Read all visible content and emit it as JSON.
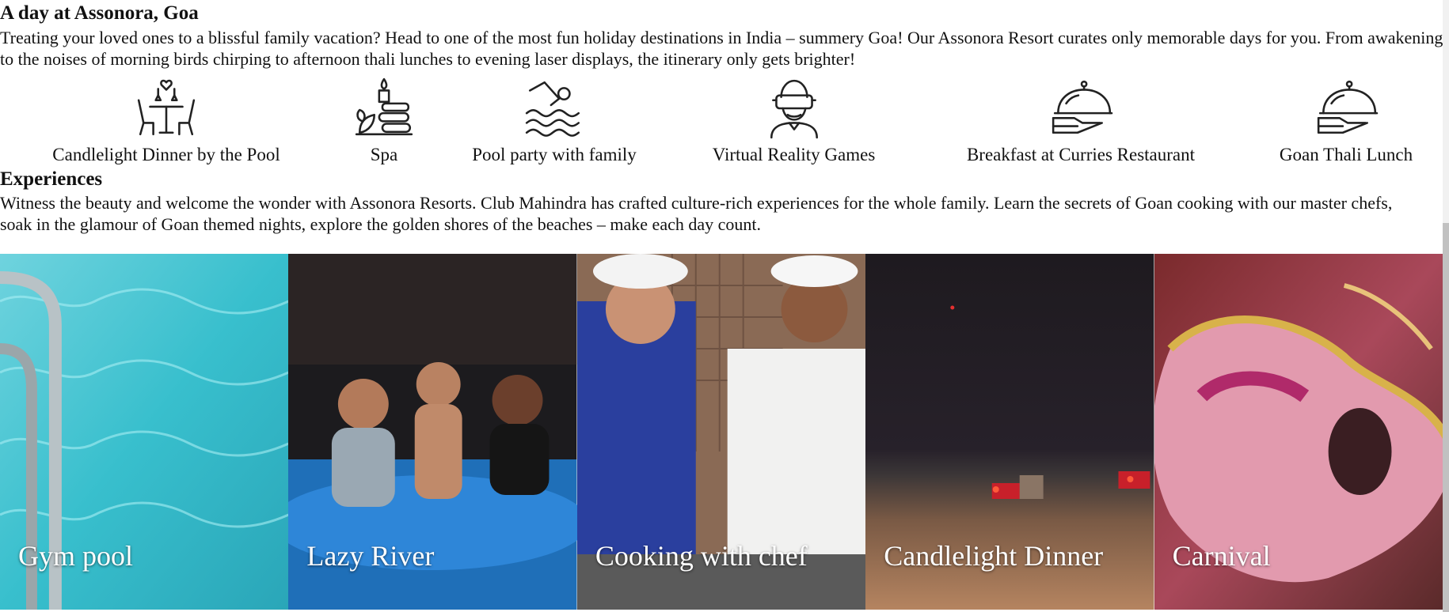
{
  "day_section": {
    "title": "A day at Assonora, Goa",
    "description": "Treating your loved ones to a blissful family vacation? Head to one of the most fun holiday destinations in India – summery Goa! Our Assonora Resort curates only memorable days for you. From awakening to the noises of morning birds chirping to afternoon thali lunches to evening laser displays, the itinerary only gets brighter!"
  },
  "amenities": [
    {
      "label": "Candlelight Dinner by the Pool",
      "icon": "candlelight-dinner-icon"
    },
    {
      "label": "Spa",
      "icon": "spa-icon"
    },
    {
      "label": "Pool party with family",
      "icon": "swimmer-icon"
    },
    {
      "label": "Virtual Reality Games",
      "icon": "vr-headset-icon"
    },
    {
      "label": "Breakfast at Curries Restaurant",
      "icon": "serving-cloche-icon"
    },
    {
      "label": "Goan Thali Lunch",
      "icon": "serving-cloche-icon"
    }
  ],
  "experiences": {
    "title": "Experiences",
    "description": "Witness the beauty and welcome the wonder with Assonora Resorts. Club Mahindra has crafted culture-rich experiences for the whole family. Learn the secrets of Goan cooking with our master chefs, soak in the glamour of Goan themed nights, explore the golden shores of the beaches – make each day count.",
    "tiles": [
      {
        "caption": "Gym pool"
      },
      {
        "caption": "Lazy River"
      },
      {
        "caption": "Cooking with chef"
      },
      {
        "caption": "Candlelight Dinner"
      },
      {
        "caption": "Carnival"
      }
    ]
  },
  "colors": {
    "text": "#111111",
    "caption": "#ffffff",
    "pool": "#3fc2cf",
    "night": "#1f1a1d",
    "carnival": "#c9526e"
  }
}
